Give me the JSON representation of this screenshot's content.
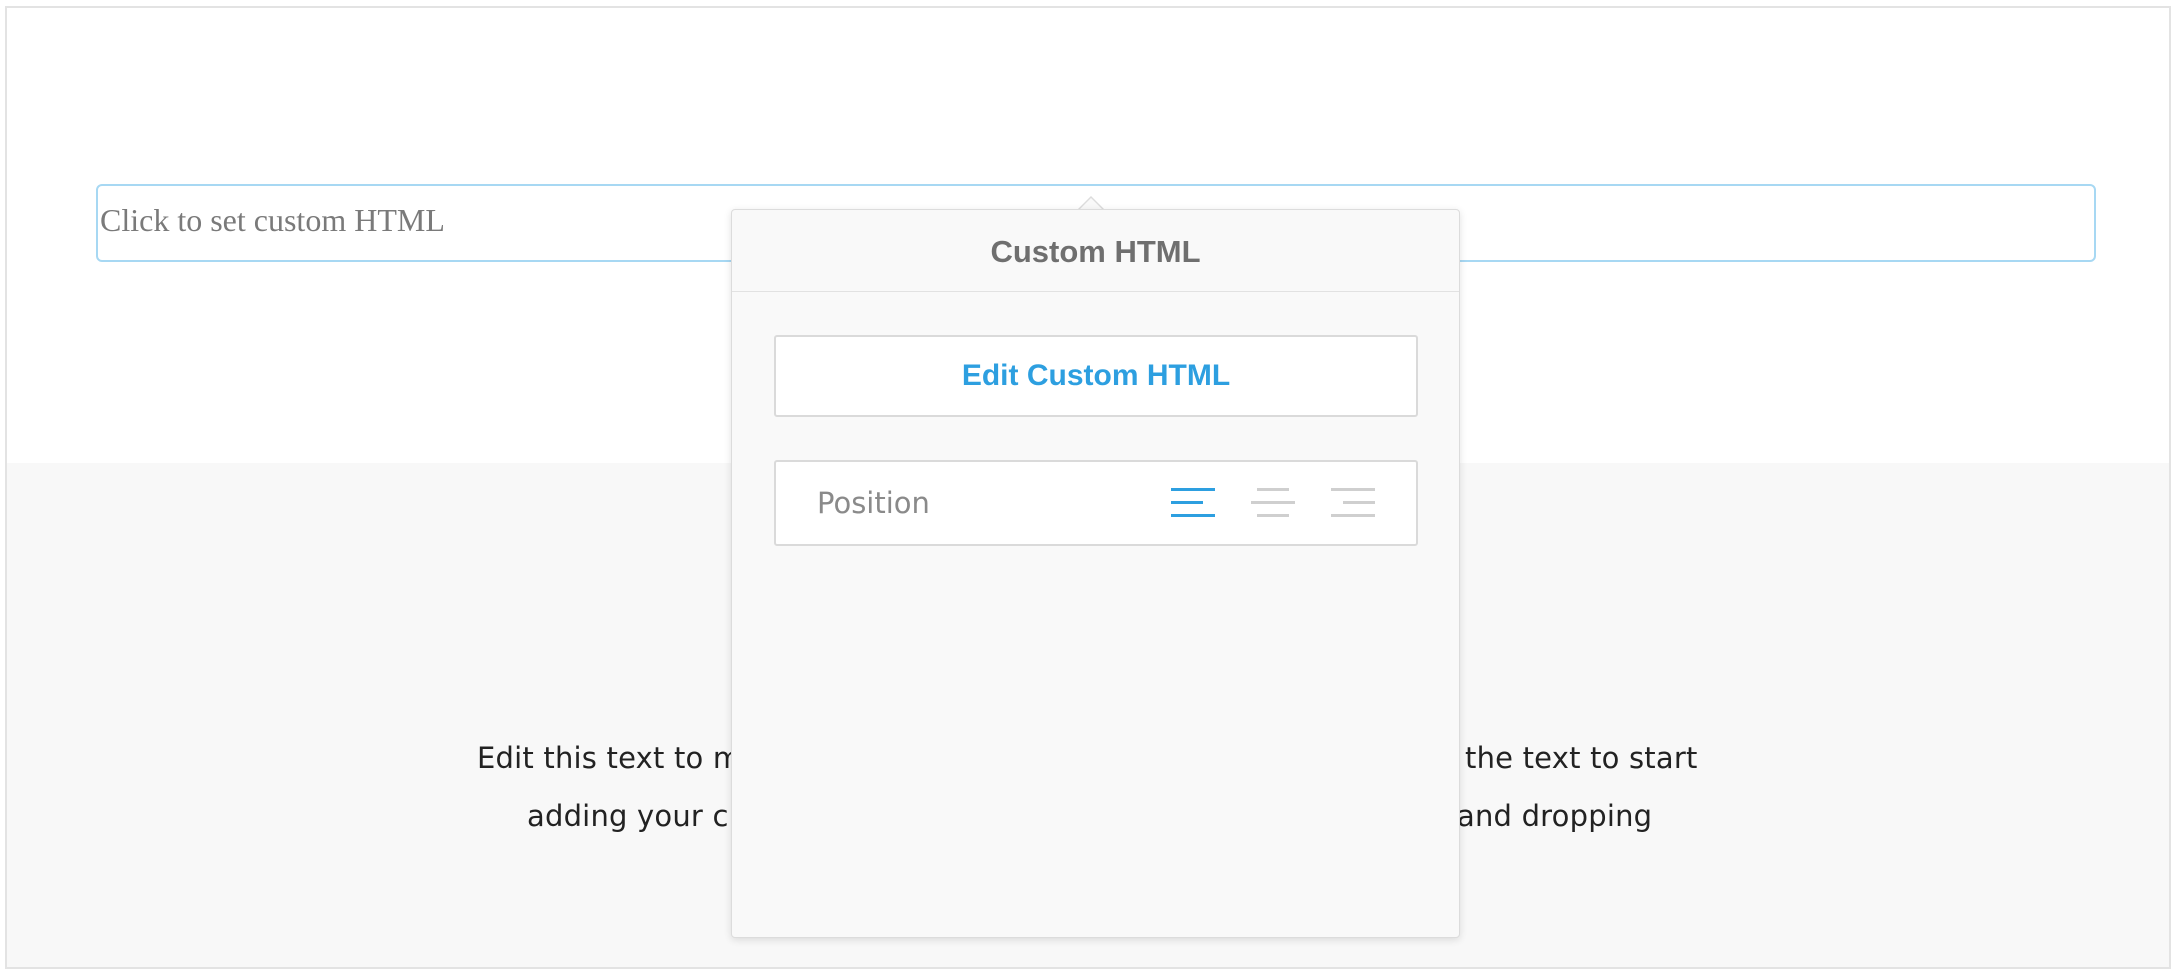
{
  "custom_html_block": {
    "placeholder": "Click to set custom HTML"
  },
  "body_text": {
    "line1": "Edit this text to m                                                                                                  the text to start",
    "line2": "adding your c                                                                                                       and dropping"
  },
  "popover": {
    "title": "Custom HTML",
    "edit_button_label": "Edit Custom HTML",
    "position_label": "Position",
    "alignment_options": [
      {
        "name": "align-left-icon",
        "active": true
      },
      {
        "name": "align-center-icon",
        "active": false
      },
      {
        "name": "align-right-icon",
        "active": false
      }
    ]
  },
  "colors": {
    "accent": "#2d9fe0",
    "inactive_icon": "#cfcfcf",
    "block_border": "#a7d8f3"
  }
}
